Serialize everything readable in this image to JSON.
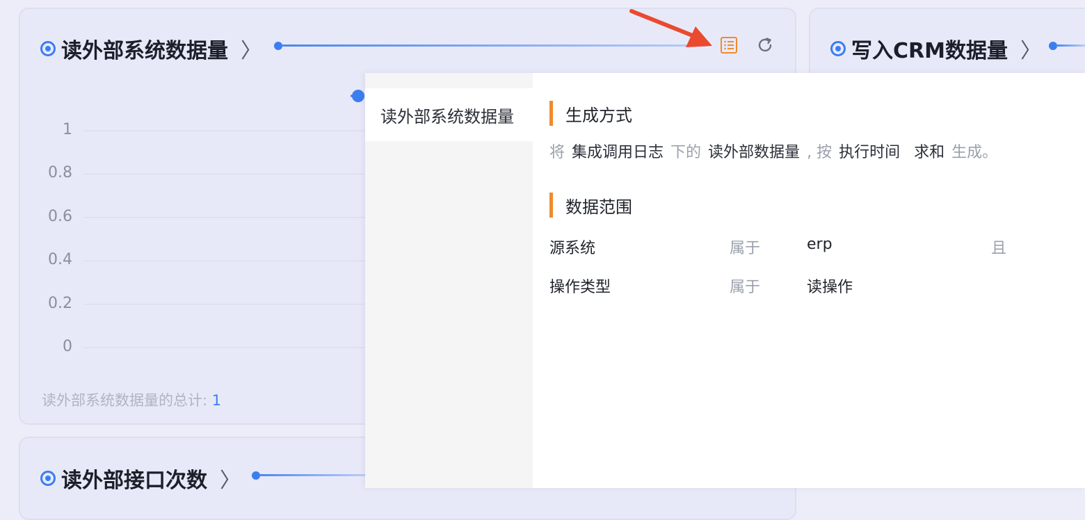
{
  "colors": {
    "accent": "#3b7ef0",
    "highlight": "#ef8b2c",
    "arrow": "#ea4a2e"
  },
  "cards": {
    "read_external": {
      "title": "读外部系统数据量",
      "yaxis_ticks": [
        "1",
        "0.8",
        "0.6",
        "0.4",
        "0.2",
        "0"
      ],
      "total_label": "读外部系统数据量的总计:",
      "total_value": "1",
      "icons": {
        "detail": "list-detail-icon",
        "refresh": "refresh-icon"
      }
    },
    "write_crm": {
      "title": "写入CRM数据量"
    },
    "read_interface": {
      "title": "读外部接口次数"
    }
  },
  "chart_data": {
    "type": "line",
    "title": "读外部系统数据量",
    "ylim": [
      0,
      1
    ],
    "yticks": [
      0,
      0.2,
      0.4,
      0.6,
      0.8,
      1
    ],
    "series": [
      {
        "values": [
          1
        ]
      }
    ]
  },
  "popup": {
    "tab_label": "读外部系统数据量",
    "generation": {
      "heading": "生成方式",
      "parts": [
        {
          "text": "将",
          "style": "g"
        },
        {
          "text": "集成调用日志",
          "style": "d"
        },
        {
          "text": "下的",
          "style": "g"
        },
        {
          "text": "读外部数据量",
          "style": "d"
        },
        {
          "text": ", 按",
          "style": "g"
        },
        {
          "text": "执行时间",
          "style": "d"
        },
        {
          "text": "求和",
          "style": "d"
        },
        {
          "text": "生成。",
          "style": "g"
        }
      ]
    },
    "scope": {
      "heading": "数据范围",
      "rows": [
        {
          "field": "源系统",
          "op": "属于",
          "value": "erp",
          "joiner": "且"
        },
        {
          "field": "操作类型",
          "op": "属于",
          "value": "读操作",
          "joiner": ""
        }
      ]
    }
  }
}
